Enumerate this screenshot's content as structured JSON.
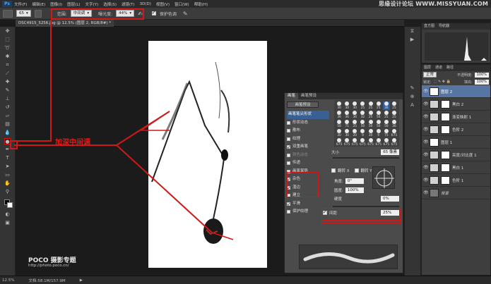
{
  "menubar": {
    "app_logo": "Ps",
    "items": [
      "文件(F)",
      "编辑(E)",
      "图像(I)",
      "图层(L)",
      "文字(Y)",
      "选择(S)",
      "滤镜(T)",
      "3D(D)",
      "视图(V)",
      "窗口(W)",
      "帮助(H)"
    ],
    "watermark": "思缘设计论坛 WWW.MISSYUAN.COM"
  },
  "options": {
    "brush_size": "65",
    "range_label": "范围:",
    "range_value": "中间调",
    "exposure_label": "曝光度:",
    "exposure_value": "44%",
    "protect_tones_label": "保护色调"
  },
  "document": {
    "tab_title": "DSC4915_5256.jpg @ 12.5% (图层 2, RGB/8#) *"
  },
  "annotation": {
    "label": "加深中间调"
  },
  "watermark_poco": {
    "brand": "POCO 摄影专题",
    "url": "http://photo.poco.cn/"
  },
  "status": {
    "zoom": "12.5%",
    "doc_size": "文档:58.1M/157.9M"
  },
  "brush_panel": {
    "tabs": [
      "画笔",
      "画笔预设"
    ],
    "preset_button": "画笔预设",
    "list": [
      {
        "label": "画笔笔尖形状",
        "checked": false,
        "header": true
      },
      {
        "label": "形状动态",
        "checked": false
      },
      {
        "label": "散布",
        "checked": false
      },
      {
        "label": "纹理",
        "checked": false
      },
      {
        "label": "双重画笔",
        "checked": true
      },
      {
        "label": "颜色动态",
        "checked": false,
        "dim": true
      },
      {
        "label": "传递",
        "checked": false
      },
      {
        "label": "画笔笔势",
        "checked": false
      },
      {
        "label": "杂色",
        "checked": true
      },
      {
        "label": "湿边",
        "checked": true
      },
      {
        "label": "建立",
        "checked": false
      },
      {
        "label": "平滑",
        "checked": true
      },
      {
        "label": "保护纹理",
        "checked": false
      }
    ],
    "tip_sizes": [
      "30",
      "30",
      "30",
      "25",
      "25",
      "25",
      "36",
      "25",
      "36",
      "36",
      "36",
      "32",
      "25",
      "50",
      "25",
      "25",
      "50",
      "71",
      "25",
      "50",
      "50",
      "50",
      "50",
      "36",
      "30",
      "30",
      "20",
      "9",
      "30",
      "9",
      "75",
      "675",
      "675",
      "675",
      "675",
      "675",
      "675",
      "675",
      "675",
      "675",
      "675",
      "675",
      "675",
      "675",
      "675",
      "675",
      "675",
      "1000",
      "1000",
      "1000",
      "1000",
      "1000",
      "1015",
      "1015"
    ],
    "selected_tip_index": 6,
    "size_label": "大小",
    "size_value": "65 像素",
    "flip_x": "翻转 X",
    "flip_y": "翻转 Y",
    "angle_label": "角度:",
    "angle_value": "0°",
    "roundness_label": "圆度:",
    "roundness_value": "100%",
    "hardness_label": "硬度",
    "hardness_value": "0%",
    "spacing_label": "间距",
    "spacing_value": "25%"
  },
  "histogram_panel": {
    "tabs": [
      "直方图",
      "导航器"
    ]
  },
  "layers_panel": {
    "tabs": [
      "图层",
      "通道",
      "路径"
    ],
    "mode": "正常",
    "opacity_label": "不透明度:",
    "opacity_value": "100%",
    "lock_label": "锁定:",
    "fill_label": "填充:",
    "fill_value": "100%",
    "layers": [
      {
        "name": "图层 2",
        "type": "white",
        "selected": true
      },
      {
        "name": "黑白 2",
        "type": "adj"
      },
      {
        "name": "渐变映射 1",
        "type": "adj"
      },
      {
        "name": "色阶 2",
        "type": "adj"
      },
      {
        "name": "图层 1",
        "type": "white"
      },
      {
        "name": "亮度/对比度 1",
        "type": "adj"
      },
      {
        "name": "黑白 1",
        "type": "adj"
      },
      {
        "name": "色阶 1",
        "type": "adj"
      },
      {
        "name": "背景",
        "type": "photo",
        "italic": true
      }
    ]
  },
  "colors": {
    "annotation_red": "#d01818",
    "selection_blue": "#3a5f92",
    "layer_selected": "#5675a2"
  }
}
